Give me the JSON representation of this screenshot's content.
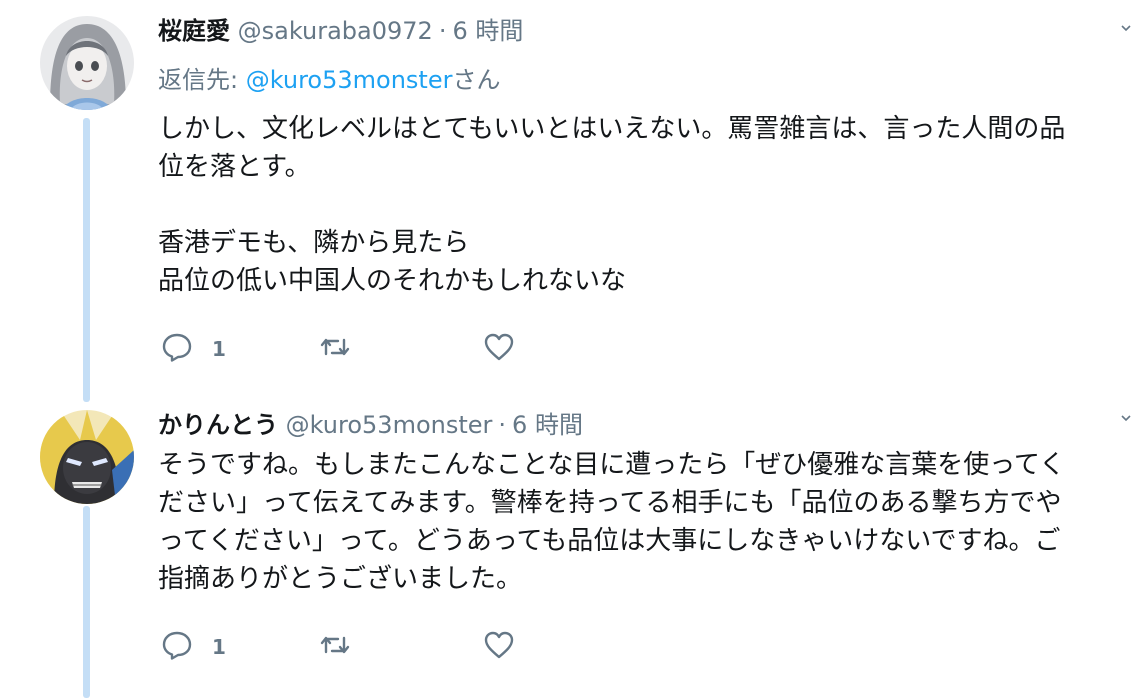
{
  "tweets": [
    {
      "name": "桜庭愛",
      "handle": "@sakuraba0972",
      "separator": "·",
      "time": "6 時間",
      "replying_prefix": "返信先: ",
      "replying_to": "@kuro53monster",
      "replying_suffix": "さん",
      "lines": [
        "しかし、文化レベルはとてもいいとはいえない。罵詈雑言は、言った人間の品",
        "位を落とす。",
        "",
        "香港デモも、隣から見たら",
        "品位の低い中国人のそれかもしれないな"
      ],
      "reply_count": "1"
    },
    {
      "name": "かりんとう",
      "handle": "@kuro53monster",
      "separator": "·",
      "time": "6 時間",
      "lines": [
        "そうですね。もしまたこんなことな目に遭ったら「ぜひ優雅な言葉を使ってく",
        "ださい」って伝えてみます。警棒を持ってる相手にも「品位のある撃ち方でや",
        "ってください」って。どうあっても品位は大事にしなきゃいけないですね。ご",
        "指摘ありがとうございました。"
      ],
      "reply_count": "1"
    }
  ],
  "icons": {
    "reply": "reply-icon",
    "retweet": "retweet-icon",
    "like": "heart-icon",
    "more": "chevron-down-icon"
  },
  "colors": {
    "link": "#1da1f2",
    "secondary_text": "#657786",
    "thread_line": "#c4def6"
  }
}
